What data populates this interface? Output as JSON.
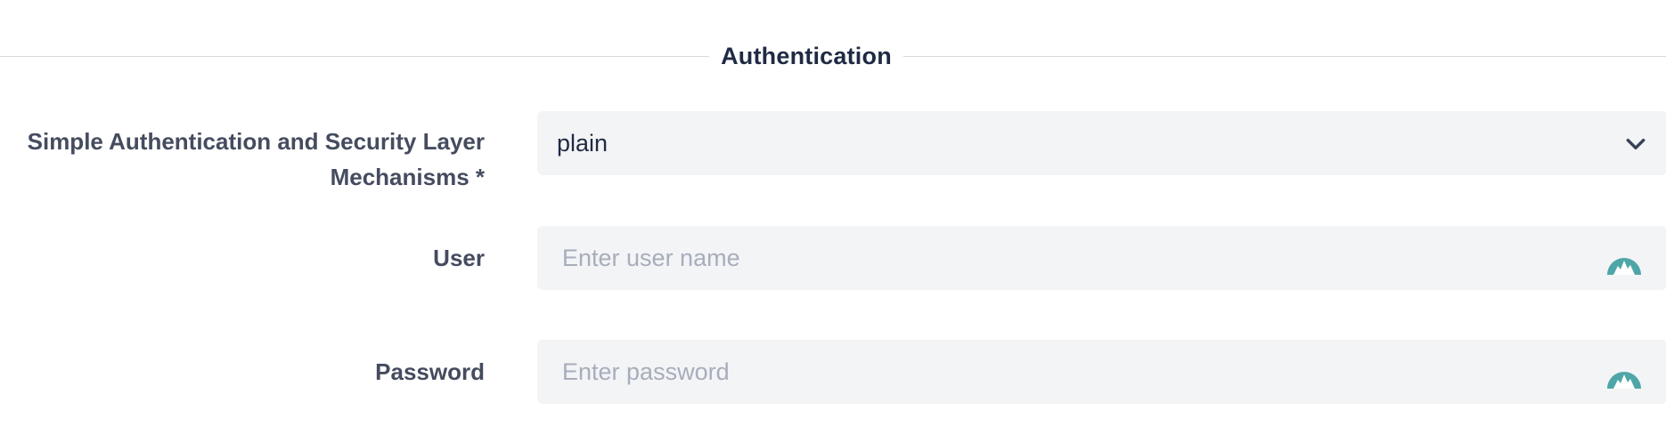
{
  "section": {
    "title": "Authentication"
  },
  "sasl": {
    "label_line1": "Simple Authentication and Security Layer",
    "label_line2": "Mechanisms *",
    "value": "plain"
  },
  "user": {
    "label": "User",
    "placeholder": "Enter user name",
    "value": "",
    "icon": "password-manager-icon"
  },
  "password": {
    "label": "Password",
    "placeholder": "Enter password",
    "value": "",
    "icon": "password-manager-icon"
  },
  "colors": {
    "icon": "#4fa6a8",
    "field_bg": "#f3f4f6",
    "divider": "#d6d9de"
  }
}
